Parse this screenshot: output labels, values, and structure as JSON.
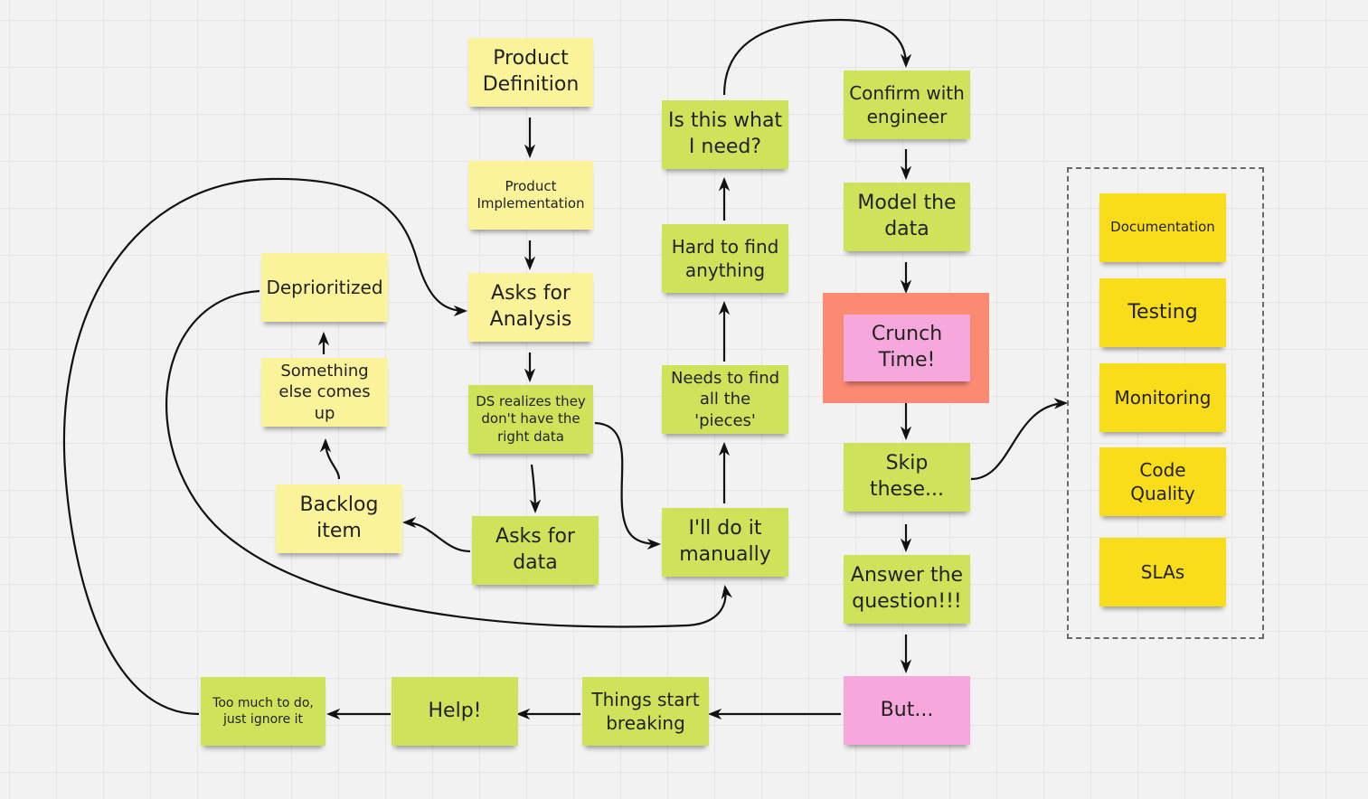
{
  "diagram": {
    "colors": {
      "background": "#f2f2f2",
      "note_pale_yellow": "#faf39a",
      "note_lime": "#cfe35a",
      "note_pink": "#f6a8dc",
      "note_gold": "#f9dc1a",
      "highlight_frame": "#fb8a73",
      "connector": "#111111"
    },
    "notes": {
      "product_definition": "Product\nDefinition",
      "product_implementation": "Product\nImplementation",
      "asks_for_analysis": "Asks for\nAnalysis",
      "ds_realizes": "DS realizes they\ndon't have the\nright data",
      "asks_for_data": "Asks for\ndata",
      "backlog_item": "Backlog\nitem",
      "something_else": "Something\nelse comes up",
      "deprioritized": "Deprioritized",
      "is_this_what": "Is this what\nI need?",
      "hard_to_find": "Hard to find\nanything",
      "needs_to_find": "Needs to find\nall the 'pieces'",
      "do_it_manually": "I'll do it\nmanually",
      "confirm_engineer": "Confirm with\nengineer",
      "model_data": "Model the\ndata",
      "crunch_time": "Crunch\nTime!",
      "skip_these": "Skip\nthese...",
      "answer_question": "Answer the\nquestion!!!",
      "but": "But...",
      "things_breaking": "Things start\nbreaking",
      "help": "Help!",
      "too_much": "Too much to do,\njust ignore it"
    },
    "skipped_group": {
      "items": [
        "Documentation",
        "Testing",
        "Monitoring",
        "Code\nQuality",
        "SLAs"
      ]
    },
    "edges": [
      [
        "Product Definition",
        "Product Implementation"
      ],
      [
        "Product Implementation",
        "Asks for Analysis"
      ],
      [
        "Asks for Analysis",
        "DS realizes they don't have the right data"
      ],
      [
        "DS realizes they don't have the right data",
        "Asks for data"
      ],
      [
        "DS realizes they don't have the right data",
        "I'll do it manually"
      ],
      [
        "Asks for data",
        "Backlog item"
      ],
      [
        "Backlog item",
        "Something else comes up"
      ],
      [
        "Something else comes up",
        "Deprioritized"
      ],
      [
        "Deprioritized",
        "I'll do it manually"
      ],
      [
        "I'll do it manually",
        "Needs to find all the 'pieces'"
      ],
      [
        "Needs to find all the 'pieces'",
        "Hard to find anything"
      ],
      [
        "Hard to find anything",
        "Is this what I need?"
      ],
      [
        "Is this what I need?",
        "Confirm with engineer"
      ],
      [
        "Confirm with engineer",
        "Model the data"
      ],
      [
        "Model the data",
        "Crunch Time!"
      ],
      [
        "Crunch Time!",
        "Skip these..."
      ],
      [
        "Skip these...",
        "Skipped group"
      ],
      [
        "Skip these...",
        "Answer the question!!!"
      ],
      [
        "Answer the question!!!",
        "But..."
      ],
      [
        "But...",
        "Things start breaking"
      ],
      [
        "Things start breaking",
        "Help!"
      ],
      [
        "Help!",
        "Too much to do, just ignore it"
      ],
      [
        "Too much to do, just ignore it",
        "Asks for Analysis"
      ]
    ]
  }
}
